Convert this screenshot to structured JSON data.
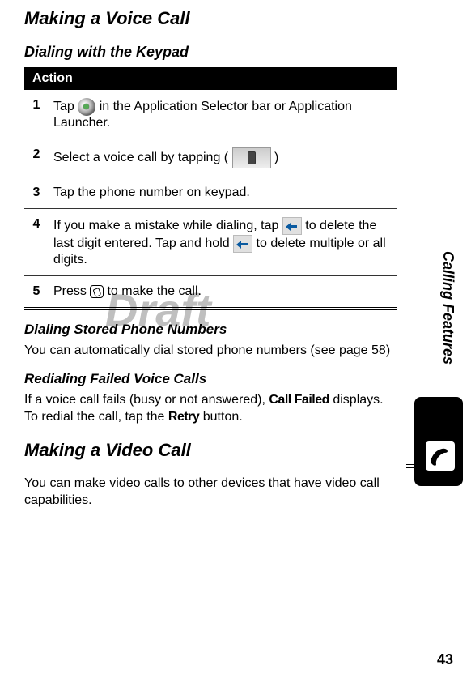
{
  "headings": {
    "h1_voice": "Making a Voice Call",
    "h2_keypad": "Dialing with the Keypad",
    "action_header": "Action",
    "h3_stored": "Dialing Stored Phone Numbers",
    "h3_redial": "Redialing Failed Voice Calls",
    "h1_video": "Making a Video Call"
  },
  "steps": {
    "s1_num": "1",
    "s1_a": "Tap ",
    "s1_b": " in the Application Selector bar or Application Launcher.",
    "s2_num": "2",
    "s2_a": "Select a voice call by tapping ( ",
    "s2_b": " )",
    "s3_num": "3",
    "s3": "Tap the phone number on keypad.",
    "s4_num": "4",
    "s4_a": "If you make a mistake while dialing, tap ",
    "s4_b": " to delete the last digit entered. Tap and hold ",
    "s4_c": " to delete multiple or all digits.",
    "s5_num": "5",
    "s5_a": "Press ",
    "s5_b": " to make the call."
  },
  "paragraphs": {
    "stored": "You can automatically dial stored phone numbers (see page 58)",
    "redial_a": "If a voice call fails (busy or not answered), ",
    "redial_b": " displays. To redial the call, tap the ",
    "redial_c": " button.",
    "callfailed": "Call Failed",
    "retry": "Retry",
    "video": "You can make video calls to other devices that have video call capabilities."
  },
  "sidebar": {
    "label": "Calling Features"
  },
  "watermark": "Draft",
  "page_number": "43"
}
